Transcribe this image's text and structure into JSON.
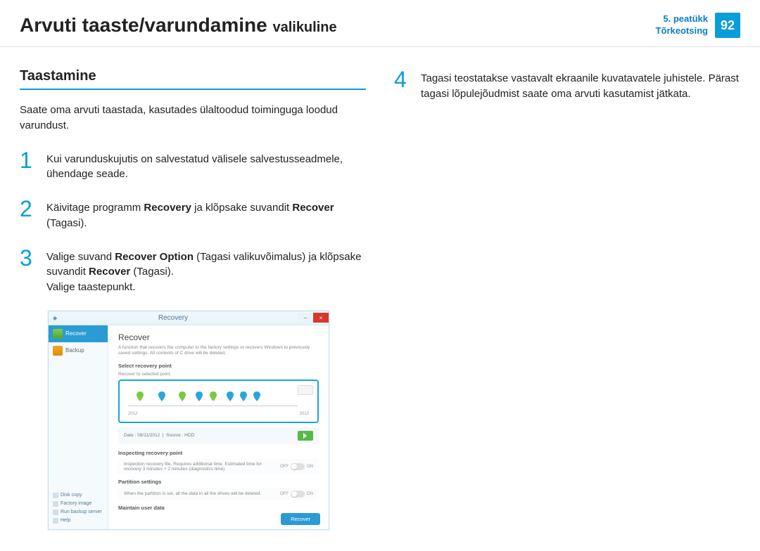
{
  "header": {
    "title_main": "Arvuti taaste/varundamine",
    "title_sub": "valikuline",
    "chapter_line1": "5. peatükk",
    "chapter_line2": "Tõrkeotsing",
    "page_number": "92"
  },
  "left": {
    "heading": "Taastamine",
    "intro": "Saate oma arvuti taastada, kasutades ülaltoodud toiminguga loodud varundust.",
    "steps": [
      {
        "num": "1",
        "html": "Kui varunduskujutis on salvestatud välisele salvestusseadmele, ühendage seade."
      },
      {
        "num": "2",
        "html": "Käivitage programm <b>Recovery</b> ja klõpsake suvandit <b>Recover</b> (Tagasi)."
      },
      {
        "num": "3",
        "html": "Valige suvand <b>Recover Option</b> (Tagasi valikuvõimalus) ja klõpsake suvandit <b>Recover</b> (Tagasi).<br>Valige taastepunkt."
      }
    ]
  },
  "right": {
    "steps": [
      {
        "num": "4",
        "html": "Tagasi teostatakse vastavalt ekraanile kuvatavatele juhistele. Pärast tagasi lõpulejõudmist saate oma arvuti kasutamist jätkata."
      }
    ]
  },
  "screenshot": {
    "window_title": "Recovery",
    "sidebar": {
      "recover": "Recover",
      "backup": "Backup",
      "links": [
        "Disk copy",
        "Factory image",
        "Run backup server",
        "Help"
      ]
    },
    "main": {
      "heading": "Recover",
      "desc": "A function that recovers the computer to the factory settings or recovers Windows to previously saved settings. All contents of C drive will be deleted.",
      "select_label": "Select recovery point",
      "select_sub": "Recover to selected point.",
      "year_start": "2012",
      "year_end": "2013",
      "date_label": "Date :",
      "date_value": "08/11/2012",
      "source_label": "Source :",
      "source_value": "HDD",
      "inspect_label": "Inspecting recovery point",
      "inspect_desc": "Inspection recovery file. Requires additional time. Estimated time for recovery 3 minutes + 2 minutes (diagnostics time)",
      "off": "OFF",
      "on": "ON",
      "partition_label": "Partition settings",
      "partition_desc": "When the partition is set, all the data in all the drives will be deleted.",
      "maintain_label": "Maintain user data",
      "recover_button": "Recover"
    }
  }
}
